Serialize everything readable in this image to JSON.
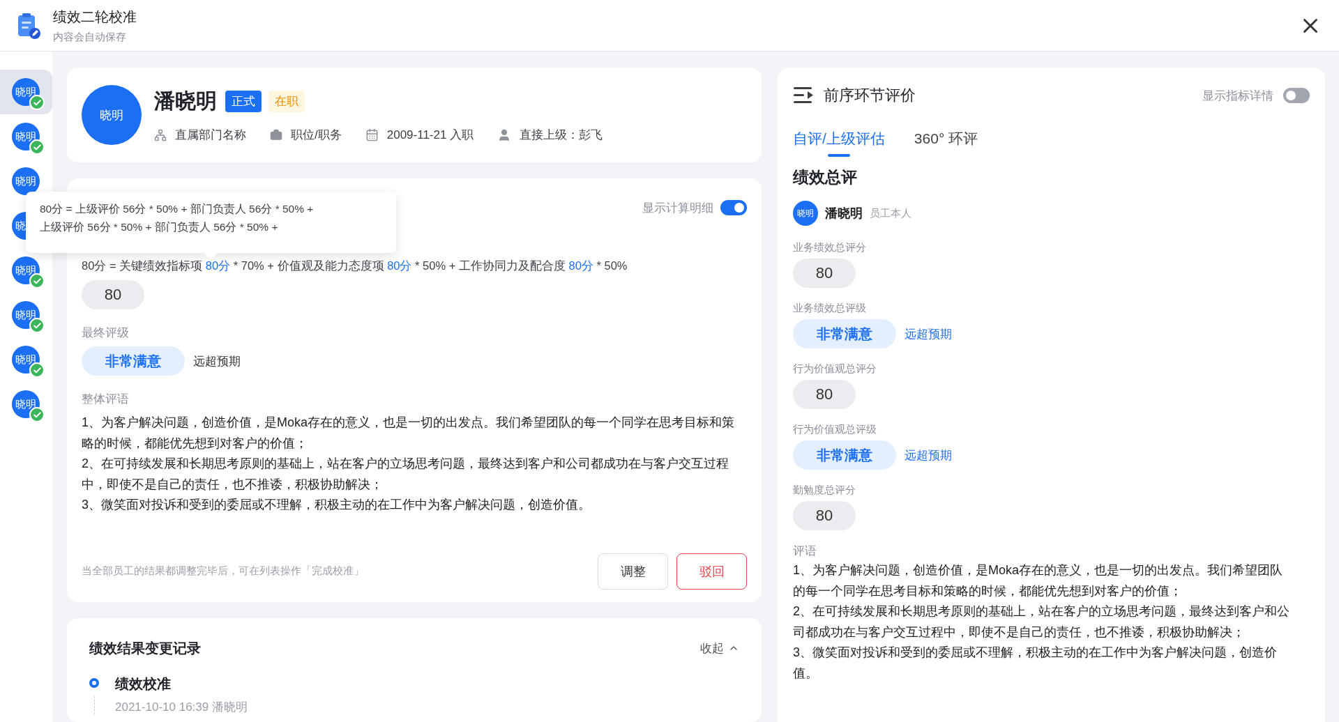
{
  "header": {
    "title": "绩效二轮校准",
    "subtitle": "内容会自动保存"
  },
  "employees": [
    {
      "label": "晓明",
      "checked": true,
      "selected": true
    },
    {
      "label": "晓明",
      "checked": true,
      "selected": false
    },
    {
      "label": "晓明",
      "selected": false
    },
    {
      "label": "晓",
      "selected": false
    },
    {
      "label": "晓明",
      "checked": true,
      "selected": false
    },
    {
      "label": "晓明",
      "checked": true,
      "selected": false
    },
    {
      "label": "晓明",
      "checked": true,
      "selected": false
    },
    {
      "label": "晓明",
      "checked": true,
      "selected": false
    }
  ],
  "profile": {
    "avatar": "晓明",
    "name": "潘晓明",
    "tags": [
      {
        "text": "正式",
        "kind": "solid"
      },
      {
        "text": "在职",
        "kind": "warning"
      }
    ],
    "meta": [
      {
        "kind": "department",
        "text": "直属部门名称"
      },
      {
        "kind": "position",
        "text": "职位/职务"
      },
      {
        "kind": "date",
        "text": "2009-11-21 入职"
      },
      {
        "kind": "manager",
        "text": "直接上级：彭飞"
      }
    ]
  },
  "calculation": {
    "toggle": {
      "label": "显示计算明细",
      "on": true
    },
    "tooltip": [
      "80分 = 上级评价 56分 * 50% + 部门负责人 56分 * 50% +",
      "上级评价 56分 * 50% + 部门负责人 56分 * 50% +"
    ],
    "formula": [
      {
        "text": "80分 = 关键绩效指标项 ",
        "highlight": false
      },
      {
        "text": "80分",
        "highlight": true
      },
      {
        "text": " * 70% + 价值观及能力态度项 ",
        "highlight": false
      },
      {
        "text": "80分",
        "highlight": true
      },
      {
        "text": " * 50% + 工作协同力及配合度 ",
        "highlight": false
      },
      {
        "text": "80分",
        "highlight": true
      },
      {
        "text": " * 50%",
        "highlight": false
      }
    ],
    "score": "80",
    "grade_label": "最终评级",
    "grade": "非常满意",
    "grade_note": "远超预期",
    "comment_label": "整体评语",
    "comment": [
      "1、为客户解决问题，创造价值，是Moka存在的意义，也是一切的出发点。我们希望团队的每一个同学在思考目标和策略的时候，都能优先想到对客户的价值；",
      "2、在可持续发展和长期思考原则的基础上，站在客户的立场思考问题，最终达到客户和公司都成功在与客户交互过程中，即使不是自己的责任，也不推诿，积极协助解决；",
      "3、微笑面对投诉和受到的委屈或不理解，积极主动的在工作中为客户解决问题，创造价值。"
    ],
    "hint": "当全部员工的结果都调整完毕后，可在列表操作「完成校准」",
    "buttons": [
      {
        "label": "调整",
        "kind": "default"
      },
      {
        "label": "驳回",
        "kind": "danger"
      }
    ]
  },
  "history": {
    "title": "绩效结果变更记录",
    "collapse": "收起",
    "entries": [
      {
        "title": "绩效校准",
        "time": "2021-10-10 16:39 潘晓明"
      }
    ]
  },
  "review": {
    "title": "前序环节评价",
    "toggle": {
      "label": "显示指标详情",
      "on": false
    },
    "tabs": [
      {
        "label": "自评/上级评估",
        "selected": true
      },
      {
        "label": "360° 环评",
        "selected": false
      }
    ],
    "section": "绩效总评",
    "reviewer": {
      "avatar": "晓明",
      "name": "潘晓明",
      "role": "员工本人"
    },
    "fields": [
      {
        "kind": "score",
        "label": "业务绩效总评分",
        "value": "80"
      },
      {
        "kind": "grade",
        "label": "业务绩效总评级",
        "value": "非常满意",
        "note": "远超预期"
      },
      {
        "kind": "score",
        "label": "行为价值观总评分",
        "value": "80"
      },
      {
        "kind": "grade",
        "label": "行为价值观总评级",
        "value": "非常满意",
        "note": "远超预期"
      },
      {
        "kind": "score",
        "label": "勤勉度总评分",
        "value": "80"
      }
    ],
    "comment_label": "评语",
    "comment": [
      "1、为客户解决问题，创造价值，是Moka存在的意义，也是一切的出发点。我们希望团队的每一个同学在思考目标和策略的时候，都能优先想到对客户的价值；",
      "2、在可持续发展和长期思考原则的基础上，站在客户的立场思考问题，最终达到客户和公司都成功在与客户交互过程中，即使不是自己的责任，也不推诿，积极协助解决；",
      "3、微笑面对投诉和受到的委屈或不理解，积极主动的在工作中为客户解决问题，创造价值。"
    ]
  }
}
